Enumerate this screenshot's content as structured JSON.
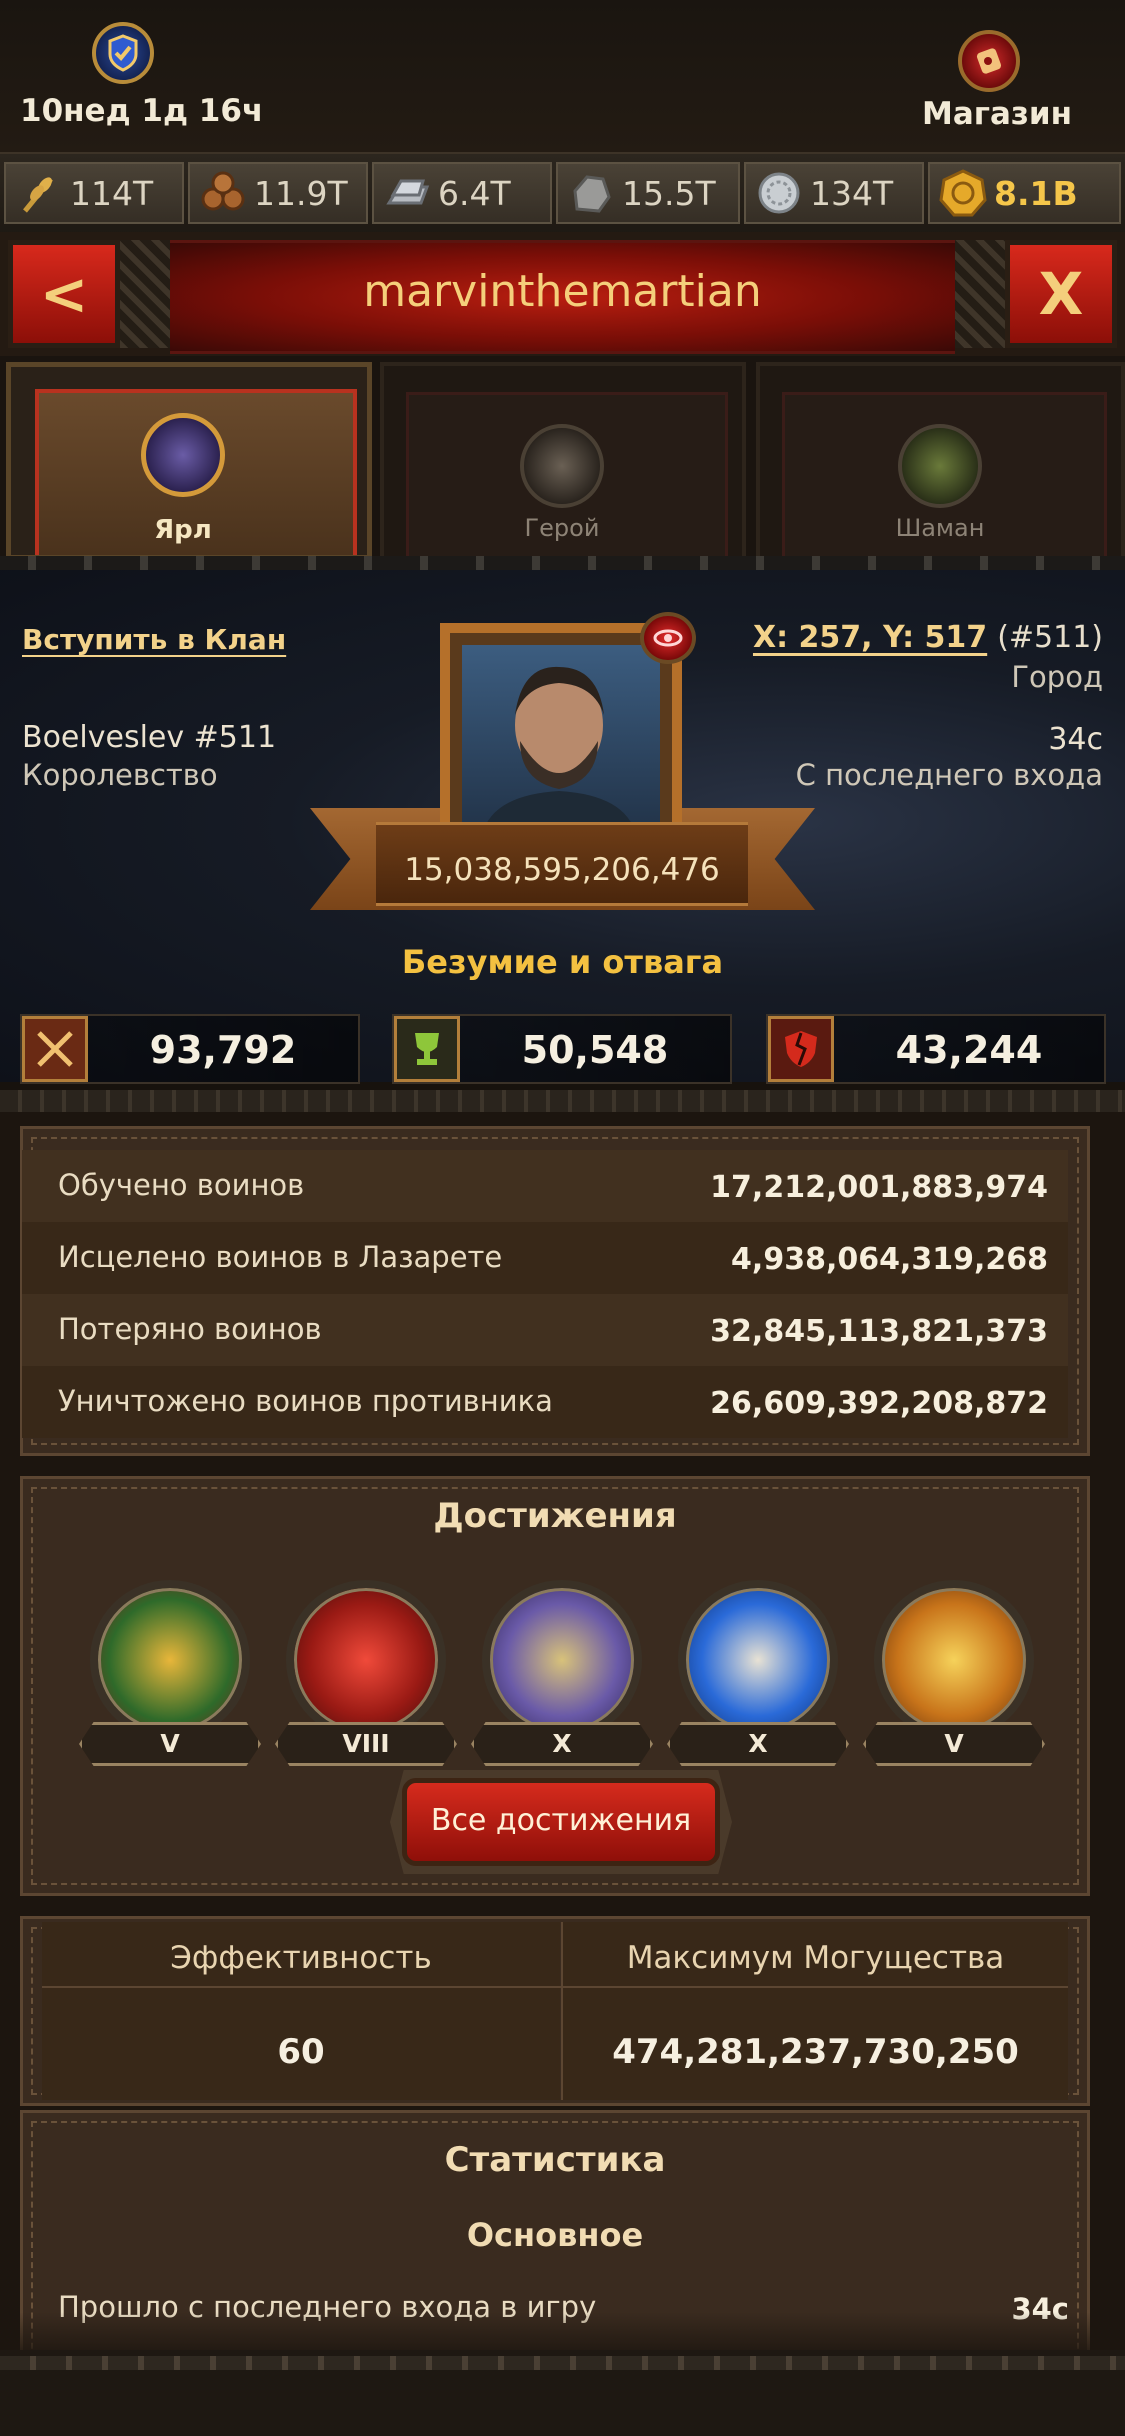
{
  "header": {
    "timer": "10нед 1д 16ч",
    "shop_label": "Магазин"
  },
  "resources": [
    {
      "icon": "wheat-icon",
      "value": "114T"
    },
    {
      "icon": "wood-icon",
      "value": "11.9T"
    },
    {
      "icon": "iron-icon",
      "value": "6.4T"
    },
    {
      "icon": "stone-icon",
      "value": "15.5T"
    },
    {
      "icon": "silver-icon",
      "value": "134T"
    },
    {
      "icon": "gold-coin-icon",
      "value": "8.1B"
    }
  ],
  "title": "marvinthemartian",
  "buttons": {
    "back": "<",
    "close": "X"
  },
  "tabs": [
    {
      "label": "Ярл",
      "active": true
    },
    {
      "label": "Герой",
      "active": false
    },
    {
      "label": "Шаман",
      "active": false
    }
  ],
  "profile": {
    "join_clan": "Вступить в Клан",
    "kingdom_name": "Boelveslev #511",
    "kingdom_label": "Королевство",
    "coords": "X: 257, Y: 517",
    "coords_suffix": "(#511)",
    "city_label": "Город",
    "last_login_value": "34с",
    "last_login_label": "С последнего входа",
    "power": "15,038,595,206,476",
    "motto": "Безумие и отвага"
  },
  "stats_row": [
    {
      "icon": "crossed-swords-icon",
      "value": "93,792"
    },
    {
      "icon": "trophy-icon",
      "value": "50,548"
    },
    {
      "icon": "broken-shield-icon",
      "value": "43,244"
    }
  ],
  "troops": [
    {
      "label": "Обучено воинов",
      "value": "17,212,001,883,974"
    },
    {
      "label": "Исцелено воинов в Лазарете",
      "value": "4,938,064,319,268"
    },
    {
      "label": "Потеряно воинов",
      "value": "32,845,113,821,373"
    },
    {
      "label": "Уничтожено воинов противника",
      "value": "26,609,392,208,872"
    }
  ],
  "achievements": {
    "title": "Достижения",
    "items": [
      {
        "icon": "golden-dragon-medal-icon",
        "level": "V"
      },
      {
        "icon": "red-gate-icon",
        "level": "VIII"
      },
      {
        "icon": "skull-knight-icon",
        "level": "X"
      },
      {
        "icon": "pirate-hat-cannon-icon",
        "level": "X"
      },
      {
        "icon": "golden-fist-icon",
        "level": "V"
      }
    ],
    "all_button": "Все достижения"
  },
  "efficiency": {
    "eff_label": "Эффективность",
    "eff_value": "60",
    "max_power_label": "Максимум Могущества",
    "max_power_value": "474,281,237,730,250"
  },
  "statistics": {
    "title": "Статистика",
    "subtitle": "Основное",
    "row_label": "Прошло с последнего входа в игру",
    "row_value": "34с"
  },
  "colors": {
    "accent_gold": "#f4c141",
    "button_red": "#c8251a",
    "panel_brown": "#3a2b1f"
  }
}
